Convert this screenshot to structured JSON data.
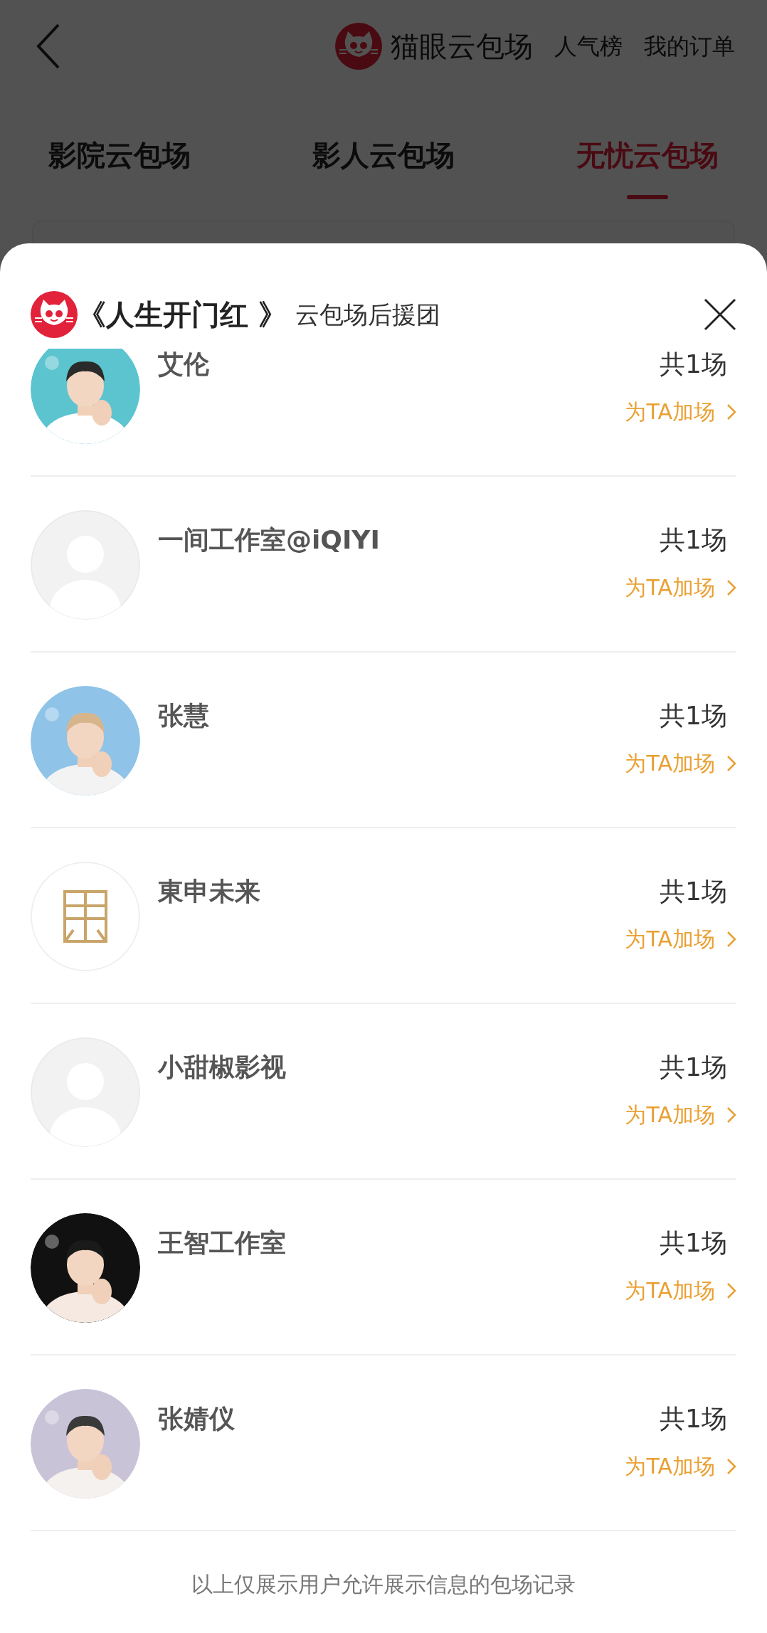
{
  "header": {
    "title": "猫眼云包场",
    "links": [
      "人气榜",
      "我的订单"
    ]
  },
  "tabs": [
    {
      "label": "影院云包场",
      "selected": false
    },
    {
      "label": "影人云包场",
      "selected": false
    },
    {
      "label": "无忧云包场",
      "selected": true
    }
  ],
  "sheet": {
    "film_title": "《人生开门红 》",
    "subtitle": "云包场后援团",
    "supporters": [
      {
        "name": "艾伦",
        "count": "共1场",
        "action": "为TA加场",
        "kind": "picture"
      },
      {
        "name": "一间工作室@iQIYI",
        "count": "共1场",
        "action": "为TA加场",
        "kind": "default"
      },
      {
        "name": "张慧",
        "count": "共1场",
        "action": "为TA加场",
        "kind": "picture"
      },
      {
        "name": "東申未来",
        "count": "共1场",
        "action": "为TA加场",
        "kind": "logo"
      },
      {
        "name": "小甜椒影视",
        "count": "共1场",
        "action": "为TA加场",
        "kind": "default"
      },
      {
        "name": "王智工作室",
        "count": "共1场",
        "action": "为TA加场",
        "kind": "picture"
      },
      {
        "name": "张婧仪",
        "count": "共1场",
        "action": "为TA加场",
        "kind": "picture"
      }
    ],
    "footer": "以上仅展示用户允许展示信息的包场记录"
  }
}
